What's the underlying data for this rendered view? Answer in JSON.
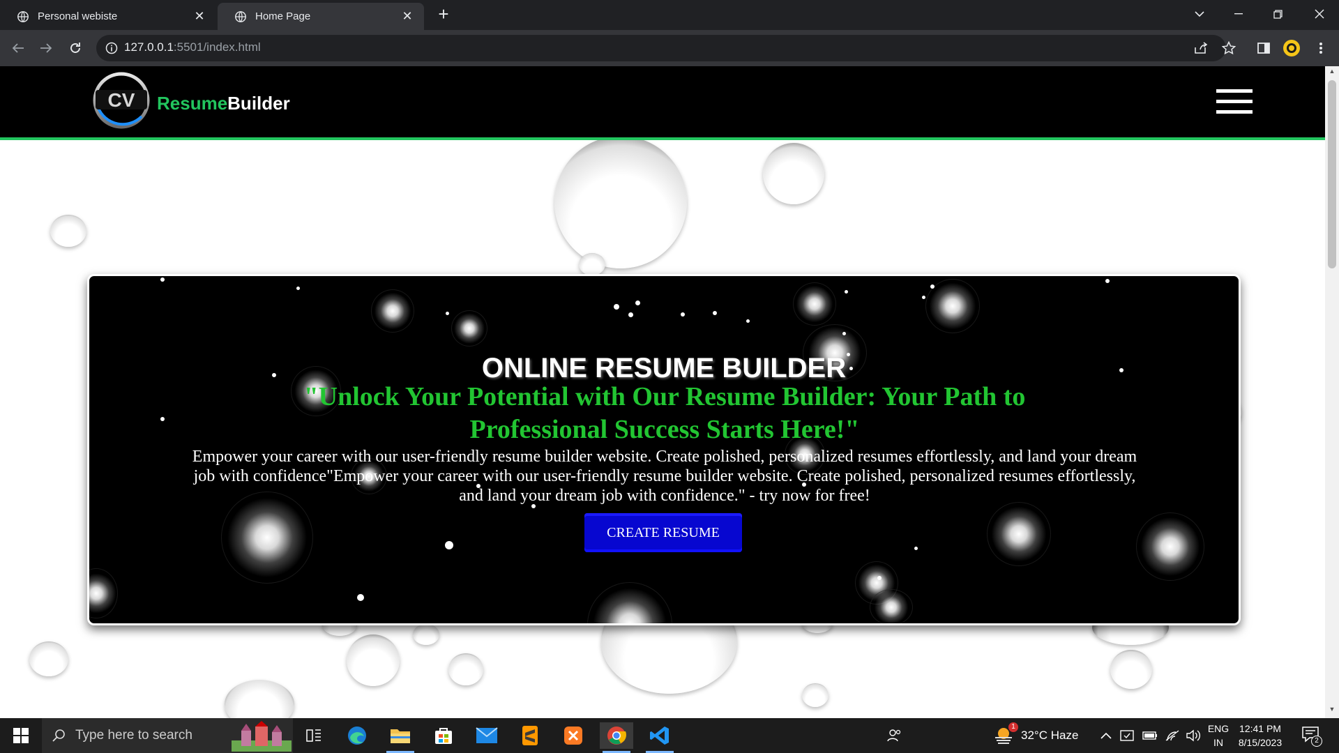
{
  "browser": {
    "tabs": [
      {
        "label": "Personal webiste",
        "active": false
      },
      {
        "label": "Home Page",
        "active": true
      }
    ],
    "url_host": "127.0.0.1",
    "url_rest": ":5501/index.html"
  },
  "site": {
    "brand_green": "Resume",
    "brand_white": "Builder",
    "logo_text": "CV",
    "hero": {
      "title": "ONLINE RESUME BUILDER",
      "tagline": "\"Unlock Your Potential with Our Resume Builder: Your Path to Professional Success Starts Here!\"",
      "description": "Empower your career with our user-friendly resume builder website. Create polished, personalized resumes effortlessly, and land your dream job with confidence\"Empower your career with our user-friendly resume builder website. Create polished, personalized resumes effortlessly, and land your dream job with confidence.\" - try now for free!",
      "cta": "CREATE RESUME"
    },
    "colors": {
      "accent_green": "#22c55e",
      "cta_blue": "#0707d0",
      "nav_bg": "#000000"
    }
  },
  "taskbar": {
    "search_placeholder": "Type here to search",
    "weather": "32°C  Haze",
    "weather_badge": "1",
    "lang_line1": "ENG",
    "lang_line2": "IN",
    "time": "12:41 PM",
    "date": "8/15/2023",
    "notification_count": "2"
  }
}
